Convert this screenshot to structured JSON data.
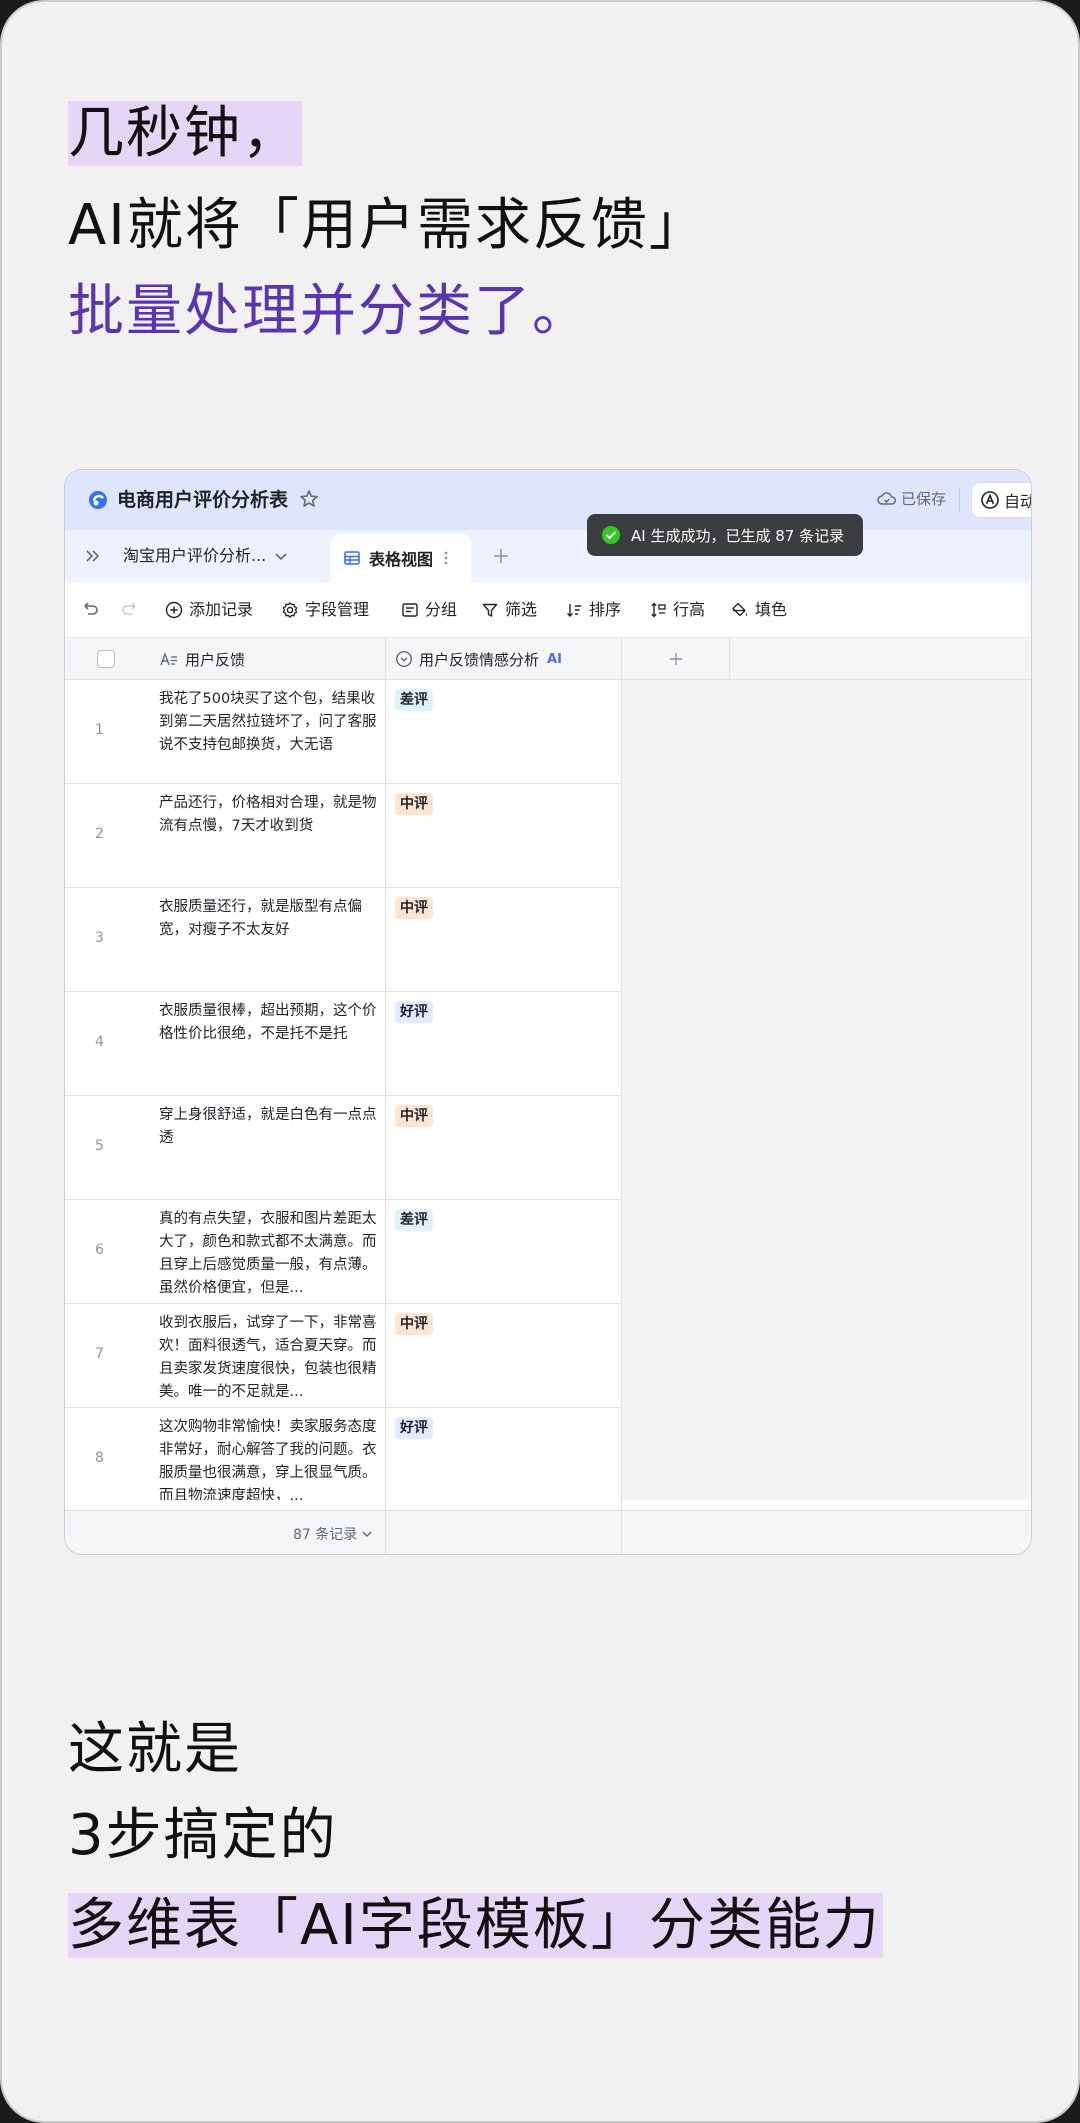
{
  "headline_top": {
    "line1": "几秒钟，",
    "line2": "AI就将「用户需求反馈」",
    "line3": "批量处理并分类了。"
  },
  "app": {
    "doc_title": "电商用户评价分析表",
    "saved_label": "已保存",
    "auto_label": "自动",
    "tabs": {
      "tab1": "淘宝用户评价分析...",
      "tab2": "表格视图"
    },
    "toast": "AI 生成成功，已生成 87 条记录",
    "toolbar": {
      "add_record": "添加记录",
      "field_manage": "字段管理",
      "group": "分组",
      "filter": "筛选",
      "sort": "排序",
      "row_height": "行高",
      "fill_color": "填色"
    },
    "columns": {
      "col1": "用户反馈",
      "col2": "用户反馈情感分析",
      "col2_ai": "AI"
    },
    "rows": [
      {
        "num": "1",
        "text": "我花了500块买了这个包，结果收到第二天居然拉链坏了，问了客服说不支持包邮换货，大无语",
        "tag": "差评"
      },
      {
        "num": "2",
        "text": "产品还行，价格相对合理，就是物流有点慢，7天才收到货",
        "tag": "中评"
      },
      {
        "num": "3",
        "text": "衣服质量还行，就是版型有点偏宽，对瘦子不太友好",
        "tag": "中评"
      },
      {
        "num": "4",
        "text": "衣服质量很棒，超出预期，这个价格性价比很绝，不是托不是托",
        "tag": "好评"
      },
      {
        "num": "5",
        "text": "穿上身很舒适，就是白色有一点点透",
        "tag": "中评"
      },
      {
        "num": "6",
        "text": "真的有点失望，衣服和图片差距太大了，颜色和款式都不太满意。而且穿上后感觉质量一般，有点薄。虽然价格便宜，但是...",
        "tag": "差评"
      },
      {
        "num": "7",
        "text": "收到衣服后，试穿了一下，非常喜欢！面料很透气，适合夏天穿。而且卖家发货速度很快，包装也很精美。唯一的不足就是...",
        "tag": "中评"
      },
      {
        "num": "8",
        "text": "这次购物非常愉快！卖家服务态度非常好，耐心解答了我的问题。衣服质量也很满意，穿上很显气质。而且物流速度超快，...",
        "tag": "好评"
      }
    ],
    "footer_count": "87 条记录",
    "tag_colors": {
      "差评": "#dff4f6",
      "中评": "#fde5d2",
      "好评": "#e1eafe"
    }
  },
  "headline_bottom": {
    "line1": "这就是",
    "line2": "3步搞定的",
    "line3": "多维表「AI字段模板」分类能力"
  }
}
